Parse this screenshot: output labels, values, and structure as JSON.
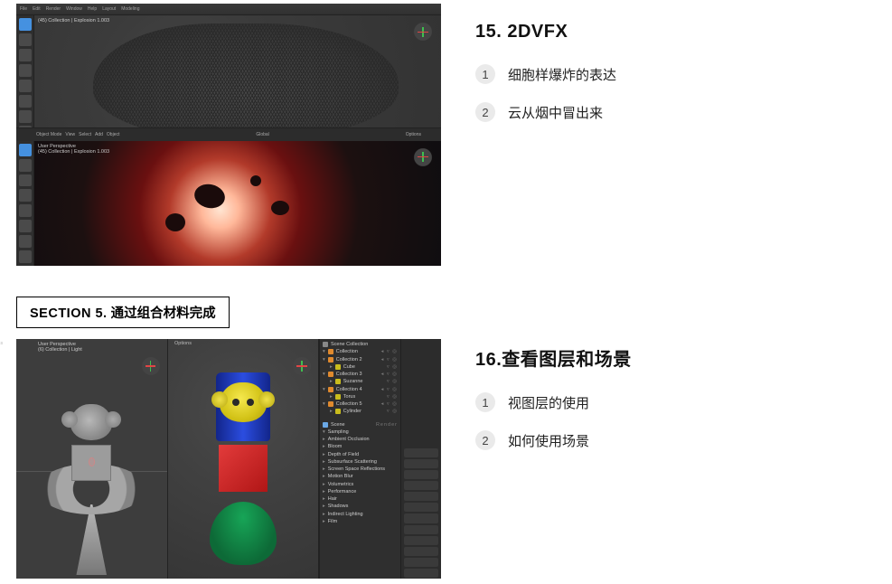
{
  "lesson15": {
    "title": "15. 2DVFX",
    "items": [
      {
        "num": "1",
        "text": "细胞样爆炸的表达"
      },
      {
        "num": "2",
        "text": "云从烟中冒出来"
      }
    ],
    "header_items": [
      "File",
      "Edit",
      "Render",
      "Window",
      "Help",
      "Layout",
      "Modeling"
    ],
    "mode_bar": [
      "Object Mode",
      "View",
      "Select",
      "Add",
      "Object",
      "Global"
    ],
    "overlay1": "(45) Collection | Explosion 1.003",
    "persp_label": "User Perspective",
    "persp_sub": "(45) Collection | Explosion 1.003",
    "options_label": "Options"
  },
  "section5": {
    "prefix": "SECTION 5.",
    "title": "通过组合材料完成"
  },
  "lesson16": {
    "title": "16.查看图层和场景",
    "items": [
      {
        "num": "1",
        "text": "视图层的使用"
      },
      {
        "num": "2",
        "text": "如何使用场景"
      }
    ],
    "options_label": "Options",
    "persp_label": "User Perspective",
    "persp_sub": "(6) Collection | Light",
    "outliner": {
      "root": "Scene Collection",
      "rows": [
        "Collection",
        "Collection 2",
        "Cube",
        "Collection 3",
        "Suzanne",
        "Collection 4",
        "Torus",
        "Collection 5",
        "Cylinder"
      ]
    },
    "props": {
      "scene_label": "Scene",
      "render_label": "Render",
      "sections": [
        "Sampling",
        "Ambient Occlusion",
        "Bloom",
        "Depth of Field",
        "Subsurface Scattering",
        "Screen Space Reflections",
        "Motion Blur",
        "Volumetrics",
        "Performance",
        "Hair",
        "Shadows",
        "Indirect Lighting",
        "Film"
      ]
    }
  }
}
